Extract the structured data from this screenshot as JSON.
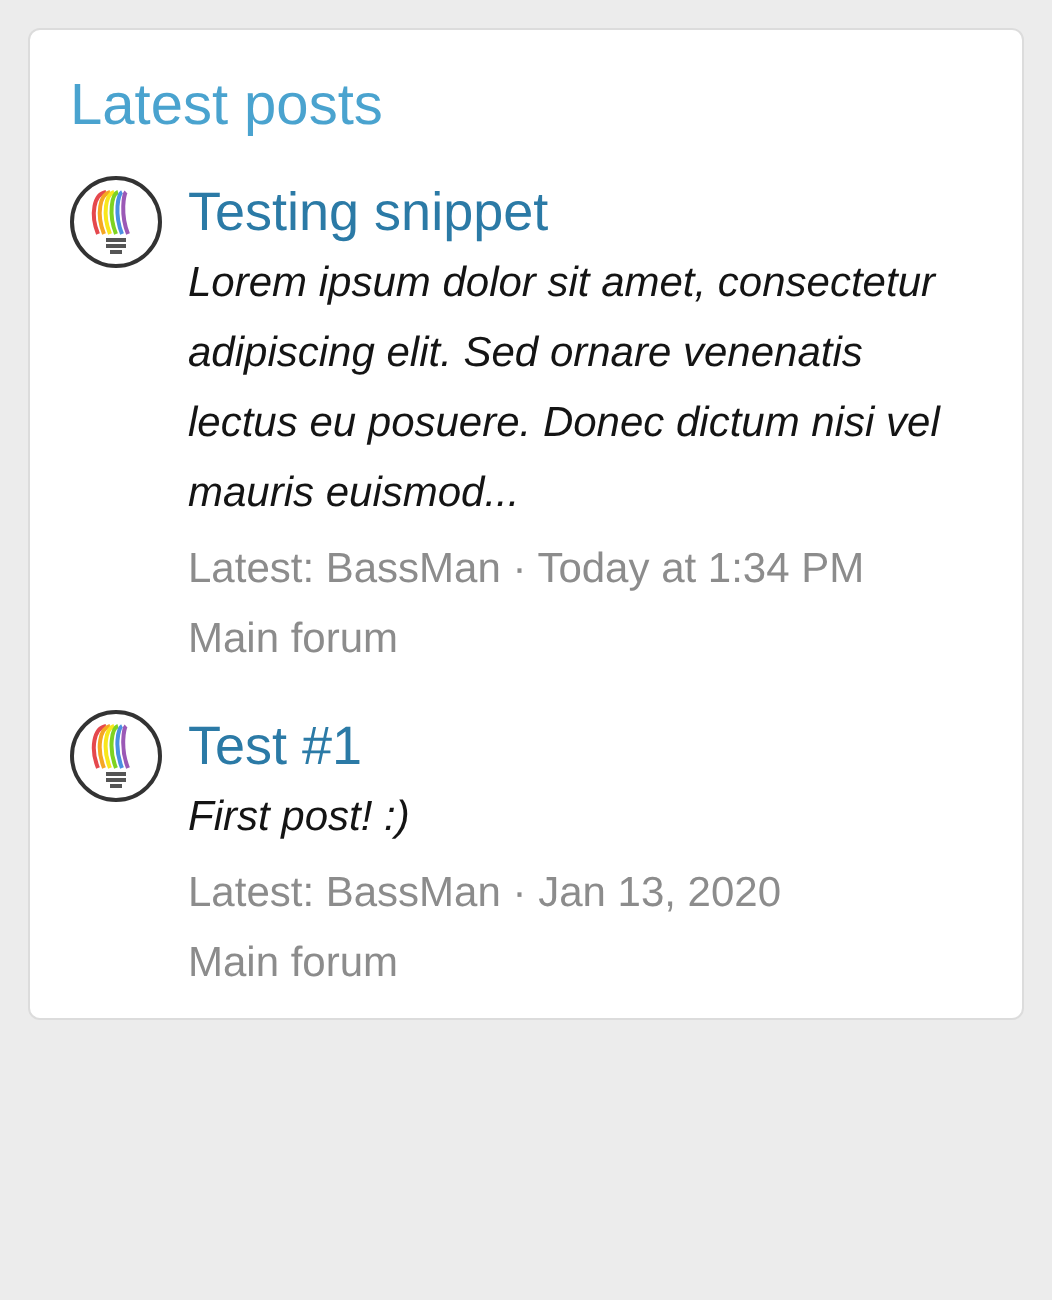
{
  "block": {
    "title": "Latest posts"
  },
  "posts": [
    {
      "title": "Testing snippet",
      "snippet": "Lorem ipsum dolor sit amet, consectetur adipiscing elit. Sed ornare venenatis lectus eu posuere. Donec dictum nisi vel mauris euismod...",
      "latest": "Latest: BassMan · Today at 1:34 PM",
      "forum": "Main forum"
    },
    {
      "title": "Test #1",
      "snippet": "First post! :)",
      "latest": "Latest: BassMan · Jan 13, 2020",
      "forum": "Main forum"
    }
  ]
}
